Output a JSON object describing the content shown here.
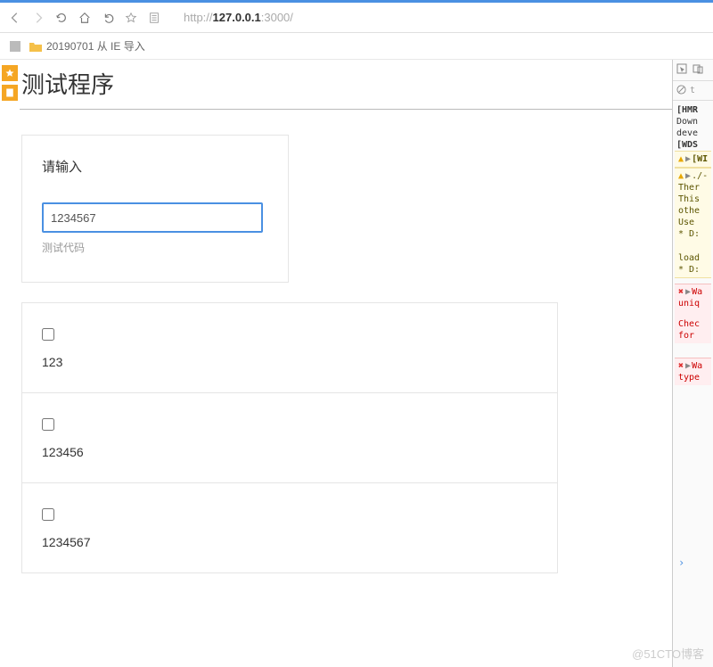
{
  "browser": {
    "url_prefix": "http://",
    "url_host": "127.0.0.1",
    "url_port": ":3000/",
    "bookmark_folder": "20190701 从 IE 导入"
  },
  "page": {
    "title": "测试程序",
    "input_card": {
      "label": "请输入",
      "value": "1234567",
      "help": "测试代码"
    },
    "items": [
      {
        "text": "123"
      },
      {
        "text": "123456"
      },
      {
        "text": "1234567"
      }
    ]
  },
  "devtools": {
    "filter_text": "t",
    "log1": "[HMR",
    "log2a": "Down",
    "log2b": "deve",
    "log3": "[WDS",
    "warn1": "[WI",
    "warn2_lines": [
      "./-",
      "Ther",
      "This",
      "othe",
      "Use",
      "* D:"
    ],
    "warn3_lines": [
      "load",
      "* D:"
    ],
    "err1_lines": [
      "Wa",
      "uniq"
    ],
    "err1b_lines": [
      "Chec",
      "for"
    ],
    "err2_lines": [
      "Wa",
      "type"
    ]
  },
  "watermark": "@51CTO博客"
}
